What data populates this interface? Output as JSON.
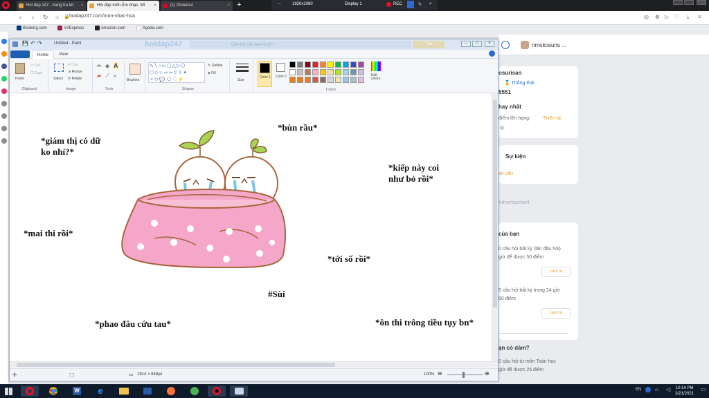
{
  "browser": {
    "tabs": [
      {
        "label": "Hỏi đáp 247 - trang tra lời"
      },
      {
        "label": "Hỏi đáp môn Âm nhạc, Mĩ"
      },
      {
        "label": "(1) Pinterest"
      }
    ],
    "new_tab": "+",
    "recorder": {
      "resolution": "1920x1080",
      "display": "Display 1",
      "rec": "REC"
    },
    "url": "hoidap247.com/mon-nhac-hoa",
    "bookmarks": [
      "Booking.com",
      "VnExpress",
      "Amazon.com",
      "Agoda.com"
    ]
  },
  "paint": {
    "title": "Untitled - Paint",
    "ghost_logo": "hoidap247",
    "ghost_search": "Câu hỏi của bạn là gì?",
    "ghost_button": "Tìm",
    "tabs": [
      "Home",
      "View"
    ],
    "ribbon": {
      "clipboard": {
        "paste": "Paste",
        "cut": "Cut",
        "copy": "Copy",
        "label": "Clipboard"
      },
      "image": {
        "select": "Select",
        "crop": "Crop",
        "resize": "Resize",
        "rotate": "Rotate",
        "label": "Image"
      },
      "tools": {
        "label": "Tools"
      },
      "brushes": "Brushes",
      "shapes": {
        "outline": "Outline",
        "fill": "Fill",
        "label": "Shapes"
      },
      "size": "Size",
      "color1": "Color 1",
      "color2": "Color 2",
      "colors_label": "Colors",
      "edit_colors": "Edit colors"
    },
    "palette": [
      "#000000",
      "#7f7f7f",
      "#880015",
      "#ed1c24",
      "#ff7f27",
      "#fff200",
      "#22b14c",
      "#00a2e8",
      "#3f48cc",
      "#a349a4",
      "#ffffff",
      "#c3c3c3",
      "#b97a57",
      "#ffaec9",
      "#ffc90e",
      "#efe4b0",
      "#b5e61d",
      "#99d9ea",
      "#7092be",
      "#c8bfe7"
    ],
    "canvas_texts": {
      "t1": "*giám thị có dữ",
      "t1b": "ko nhỉ?*",
      "t2": "*bùn rầu*",
      "t3": "*kiếp này coi",
      "t3b": "như bỏ rồi*",
      "t4": "*mai thi rồi*",
      "t5": "*tới số rồi*",
      "t6": "#Sùi",
      "t7": "*phao đâu cứu tau*",
      "t8": "*ôn thi trông tiều tụy bn*"
    },
    "status": {
      "dimensions": "1914 × 848px",
      "zoom": "100%"
    }
  },
  "site": {
    "username": "nmokosuris ...",
    "profile_name": "osurisan",
    "rank": "Thông thái",
    "points": "5551",
    "hay_nhat": "hay nhất",
    "diem_len_hang": "điểm lên hạng:",
    "next_rank": "Thiên tài",
    "events_title": "Sự kiện",
    "events_link": "ạn văn",
    "advertisement": "Advertisement",
    "tasks_title": "của bạn",
    "task1": "0 câu hỏi bất kỳ (lần đầu hỏi)",
    "task1b": "giờ để được 50 điểm",
    "task_btn": "Làm lu",
    "task2": "5 câu hỏi bất kỳ trong 24 giờ",
    "task2b": "50 điểm",
    "task_btn2": "Làm lu",
    "q_title": "ạn có dám?",
    "q1": "0 câu hỏi từ môn Toán học",
    "q1b": "giờ để được 25 điểm"
  },
  "taskbar": {
    "lang": "EN",
    "time": "10:14 PM",
    "date": "3/21/2021"
  }
}
